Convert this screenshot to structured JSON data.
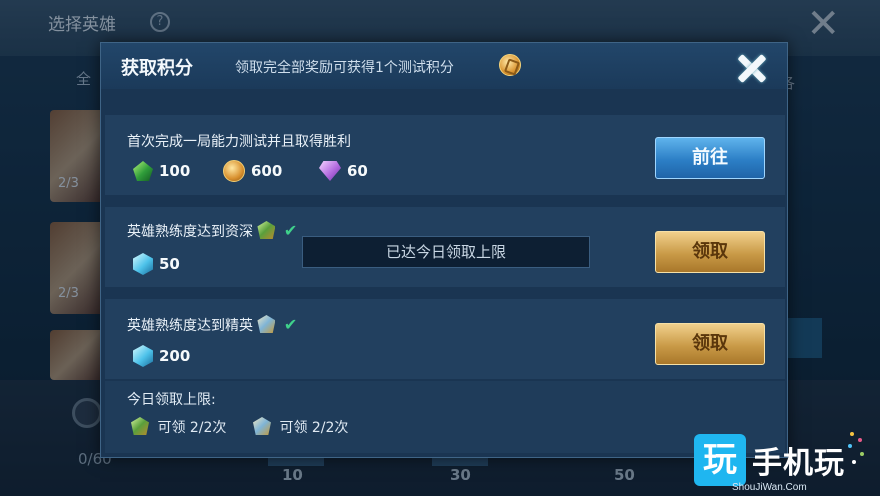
{
  "background": {
    "title": "选择英雄",
    "help_icon": "question-icon",
    "close_icon": "close-icon",
    "tab_left": "全",
    "tab_right": "各",
    "card_labels": [
      "2/3",
      "2/3"
    ],
    "bottom_left_value": "0/60",
    "milestones": [
      "10",
      "30",
      "50"
    ]
  },
  "dialog": {
    "title": "获取积分",
    "subtitle": "领取完全部奖励可获得1个测试积分",
    "subtitle_icon": "coin-icon",
    "close_icon": "close-icon",
    "tasks": [
      {
        "label": "首次完成一局能力测试并且取得胜利",
        "rewards": [
          {
            "icon": "emerald-icon",
            "amount": "100"
          },
          {
            "icon": "gold-coin-icon",
            "amount": "600"
          },
          {
            "icon": "diamond-icon",
            "amount": "60"
          }
        ],
        "button": "前往",
        "button_style": "blue"
      },
      {
        "label": "英雄熟练度达到资深",
        "badge_icon": "veteran-badge-icon",
        "completed": true,
        "rewards": [
          {
            "icon": "crystal-cube-icon",
            "amount": "50"
          }
        ],
        "button": "领取",
        "button_style": "gold"
      },
      {
        "label": "英雄熟练度达到精英",
        "badge_icon": "elite-badge-icon",
        "completed": true,
        "rewards": [
          {
            "icon": "crystal-cube-icon",
            "amount": "200"
          }
        ],
        "button": "领取",
        "button_style": "gold"
      }
    ],
    "toast": "已达今日领取上限",
    "footer": {
      "title": "今日领取上限:",
      "limits": [
        {
          "icon": "veteran-badge-icon",
          "text": "可领 2/2次"
        },
        {
          "icon": "elite-badge-icon",
          "text": "可领 2/2次"
        }
      ]
    }
  },
  "watermark": {
    "logo_char": "玩",
    "text": "手机玩",
    "url": "ShouJiWan.Com"
  }
}
